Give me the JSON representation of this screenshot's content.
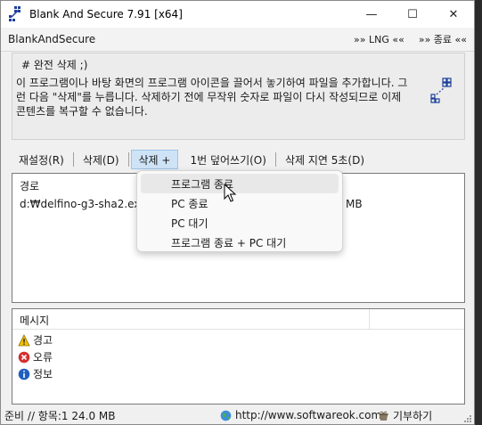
{
  "window": {
    "title": "Blank And Secure 7.91 [x64]",
    "minimize": "—",
    "maximize": "☐",
    "close": "✕"
  },
  "brandbar": {
    "name": "BlankAndSecure",
    "lng": "»» LNG ««",
    "exit": "»» 종료 ««"
  },
  "info": {
    "heading": "# 완전 삭제 ;)",
    "body": "이 프로그램이나 바탕 화면의 프로그램 아이콘을 끌어서 놓기하여 파일을 추가합니다. 그런 다음 \"삭제\"를 누릅니다. 삭제하기 전에 무작위 숫자로 파일이 다시 작성되므로 이제 콘텐츠를 복구할 수 없습니다."
  },
  "toolbar": {
    "reset": "재설정(R)",
    "delete": "삭제(D)",
    "delete_plus": "삭제 +",
    "overwrite_once": "1번 덮어쓰기(O)",
    "delete_delay": "삭제 지연 5초(D)"
  },
  "filelist": {
    "header": "경로",
    "rows": [
      {
        "path": "d:₩delfino-g3-sha2.exe",
        "size": "MB"
      }
    ]
  },
  "dropdown": {
    "items": [
      "프로그램 종료",
      "PC 종료",
      "PC 대기",
      "프로그램 종료 + PC 대기"
    ]
  },
  "messages": {
    "header": "메시지",
    "items": [
      {
        "label": "경고",
        "icon": "warning-icon",
        "color": "#f2c200"
      },
      {
        "label": "오류",
        "icon": "error-icon",
        "color": "#d32f2f"
      },
      {
        "label": "정보",
        "icon": "info-icon",
        "color": "#1f5fbf"
      }
    ]
  },
  "statusbar": {
    "status": "준비 // 항목:1 24.0 MB",
    "url": "http://www.softwareok.com",
    "donate": "기부하기"
  }
}
